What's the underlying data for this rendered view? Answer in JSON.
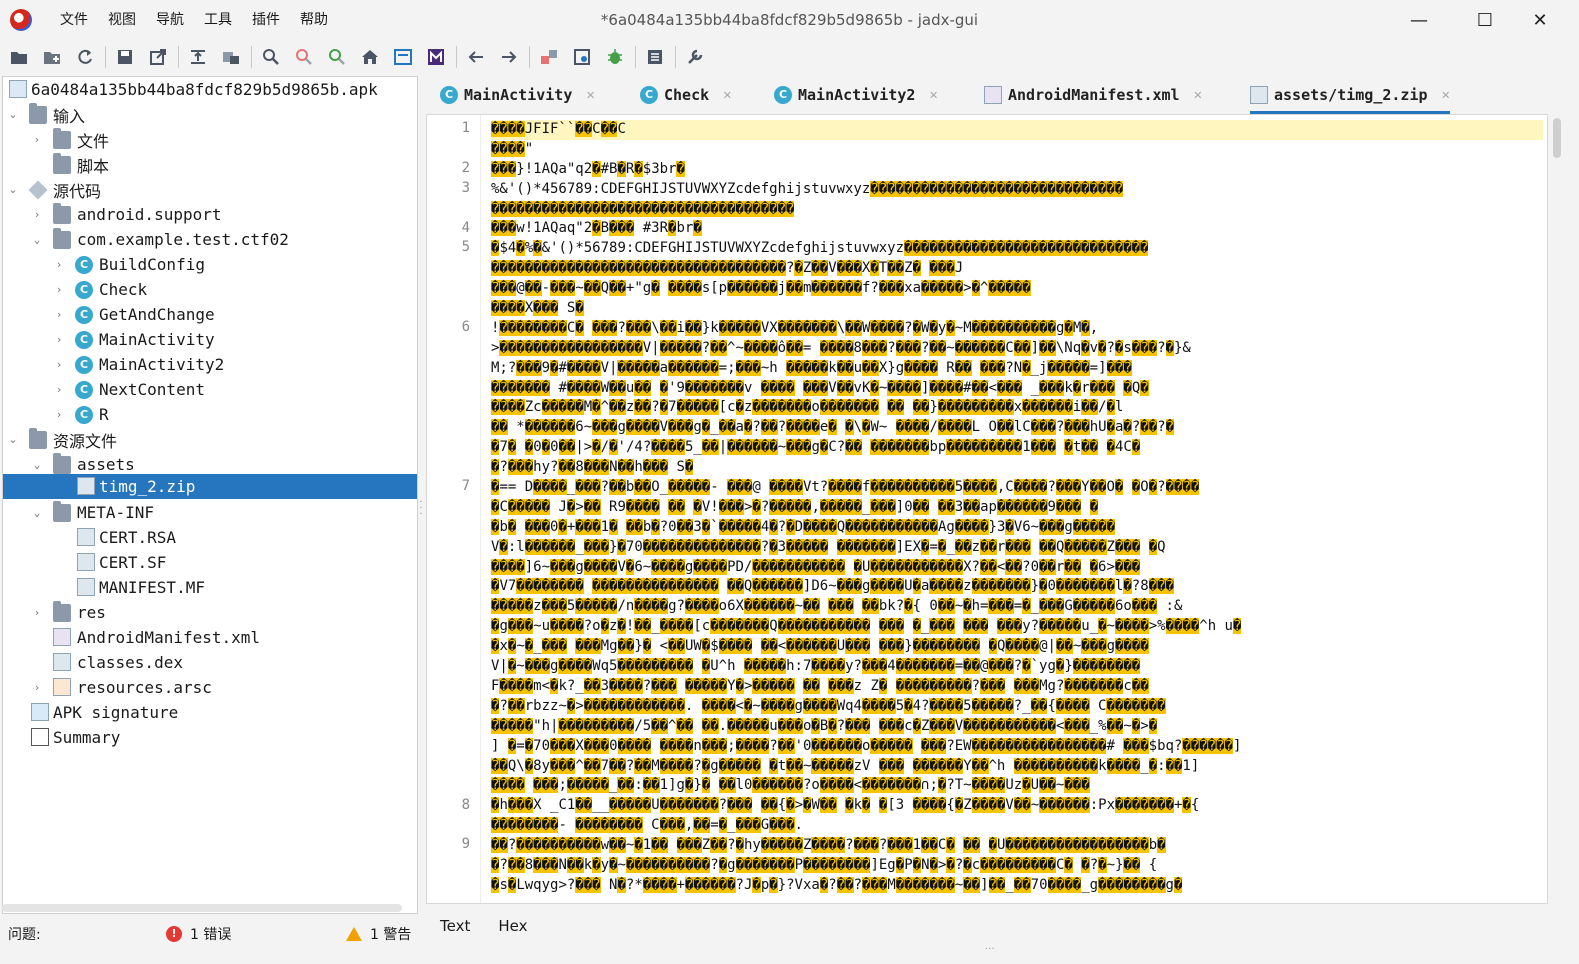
{
  "window": {
    "title": "*6a0484a135bb44ba8fdcf829b5d9865b - jadx-gui",
    "minimize": "—",
    "maximize": "☐",
    "close": "✕"
  },
  "menu": [
    "文件",
    "视图",
    "导航",
    "工具",
    "插件",
    "帮助"
  ],
  "toolbar": [
    "open-icon",
    "add-files-icon",
    "reload-icon",
    "save-all-icon",
    "export-icon",
    "sync-icon",
    "flatten-icon",
    "search-icon",
    "find-class-icon",
    "find-usage-icon",
    "home-icon",
    "log-icon",
    "smali-icon",
    "back-icon",
    "forward-icon",
    "deobfuscate-icon",
    "quark-icon",
    "debug-icon",
    "decompile-all-icon",
    "preferences-icon"
  ],
  "tree": {
    "root": "6a0484a135bb44ba8fdcf829b5d9865b.apk",
    "input": "输入",
    "files": "文件",
    "scripts": "脚本",
    "source": "源代码",
    "pkg_android": "android.support",
    "pkg_example": "com.example.test.ctf02",
    "classes": [
      "BuildConfig",
      "Check",
      "GetAndChange",
      "MainActivity",
      "MainActivity2",
      "NextContent",
      "R"
    ],
    "resources": "资源文件",
    "assets": "assets",
    "timg": "timg_2.zip",
    "meta_inf": "META-INF",
    "cert_rsa": "CERT.RSA",
    "cert_sf": "CERT.SF",
    "manifest_mf": "MANIFEST.MF",
    "res": "res",
    "android_manifest": "AndroidManifest.xml",
    "classes_dex": "classes.dex",
    "resources_arsc": "resources.arsc",
    "apk_signature": "APK signature",
    "summary": "Summary"
  },
  "tabs": [
    {
      "label": "MainActivity",
      "icon": "C"
    },
    {
      "label": "Check",
      "icon": "C"
    },
    {
      "label": "MainActivity2",
      "icon": "C"
    },
    {
      "label": "AndroidManifest.xml",
      "icon": "MF"
    },
    {
      "label": "assets/timg_2.zip",
      "icon": "file"
    }
  ],
  "tab_close": "✕",
  "line_numbers": [
    "1",
    "2",
    "3",
    "4",
    "5",
    "6",
    "7",
    "8",
    "9"
  ],
  "code_lines": [
    "����JFIF``��C��C",
    "����\"",
    "���}!1AQa\"q2�#B�R�$3br�",
    "%&'()*456789:CDEFGHIJSTUVWXYZcdefghijstuvwxyz������������������������������",
    "������������������������������������",
    "���w!1AQaq\"2�B���   #3R�br�",
    "�$4�%�&'()*56789:CDEFGHIJSTUVWXYZcdefghijstuvwxyz�����������������������������",
    "�����������������������������������?�Z��V���X�T��Z� ���J",
    "���@��-���~��Q��+\"g� ����s[p������j��m������f?���xa�����>�^�����",
    "����X��� S�",
    "!��������C� ���?���\\��i��}k�����VX�������\\��W����?�W�y�~M����������g�M�,",
    ">�����������������V|�����?��^~����ô��= ����8���?���?��~������C��]��\\Nq�v�?�s���?�}&",
    "M;?���9�#����V|�����a������=;���~h �����k��u��X}g���� R�� ���?N�_j�����=]���",
    "������� #����W��u�� �'9�������v ���� ���V��vK�~����]����#��<��� _���k�r��� �Q�",
    "����Zc�����M�^��z��?�7�����[c�z�������o������� �� ��}���������x������i��/�l",
    "�� *������6~���g����V���g�_��a�?��?����e� �\\�W~ ����/����L O��lC���?���hU�a�?��?�",
    "�7� �0�0��|>�/�'/4?����5_��|������~���g�C?�� �������bp���������1��� �t�� �4C�",
    "�?���hy?��8���N��h��� S�",
    "�== D����_���?��b��O_�����- ���@ ����Vt?����f����������5����,C����?���Y��O� �O�?����",
    "�C����� J�>�� R9���� �� �V!���>�?�����,�����_���]0�� ��3��ap������9��� �",
    "�b� ���0�+���1� ��b�?0��3�`�����4�?�D����Q�����������Ag����}3�V6~���g�����",
    "V�:l������_���}�70��������������?�3����� �������]EX�=�_��z��r��� ��Q�����Z��� �Q",
    "����]6~���g����V�6~����g����PD/����������� �U�����������X?��<��?0��r�� �6>���",
    "�V7�������� ��������������� ��Q������]D6~���g����U�a����z�������}�0�������l�?8���",
    "�����z���5�����/n����g?����o6X������~�� ��� ��bk?�{ 0��~�h=���=�_���G�����6o��� :&",
    "�g���~u����?o�z�!��_����[c�������Q����������� ��� �_��� ��� ���y?�����u_�~����>%����^h u�",
    "�x�~�_��� ���Mg��}� <��UW�$���� ��<������U��� ���}�������� �Q����@|��~���g����",
    "V|�~���g����Wq5��������� �U^h �����h:7����y?���4�������=��@���?�`yg�}��������",
    "F����m<�k?_��3����?��� �����Y�>����� �� ���z Z� ���������?��� ���Mg?�������c��",
    "�?��rbzz~�>������������. ����<�~����g����Wq4����5�4?����5�����?_��{���� C�������",
    "�����\"h|���������/5��^�� ��.�����u���o�B�?��� ���c�Z���V�����������<���_%��~�>�",
    "] �=�70���X���0���� ����n���;����?��'0������o����� ���?EW����������������# ���$bq?������]",
    "��Q\\�8y���^��7��?��M����?�g����� �t��~�����zV ��� ������Y��^h ����������k����_�:��1]",
    "���� ���;�����_��:��1]g�}� ��l0������?o����<�������∩;�?T~����Uz�U��~���",
    "�h���X _C1��__�����U�������?��� ��{�>�W�� �k� �[3 ����{�Z����V��~������:Px�������+�{",
    "��������- �������� C���,��=�_���G���.",
    "��?����������w��~�1�� ���Z��?�hy�����Z����?���?���1��C� �� �U�����������������b�",
    "�?��8���N��k�y�~����������?�g�������P��������]Eg�P�N�>�?�c���������C� �?�~}�� {",
    "�s�Lwqyg>?��� N�?*����+������?J�p�}?Vxa�?��?���M�������~��]��_��70����_g��������g�"
  ],
  "line_number_rows": [
    0,
    2,
    3,
    5,
    6,
    10,
    18,
    34,
    36
  ],
  "view_tabs": {
    "text": "Text",
    "hex": "Hex"
  },
  "status": {
    "problems_label": "问题:",
    "errors": "1 错误",
    "warnings": "1 警告"
  },
  "colors": {
    "highlight": "#f5c400",
    "selection": "#2675bf",
    "class_icon": "#37a9cf"
  }
}
